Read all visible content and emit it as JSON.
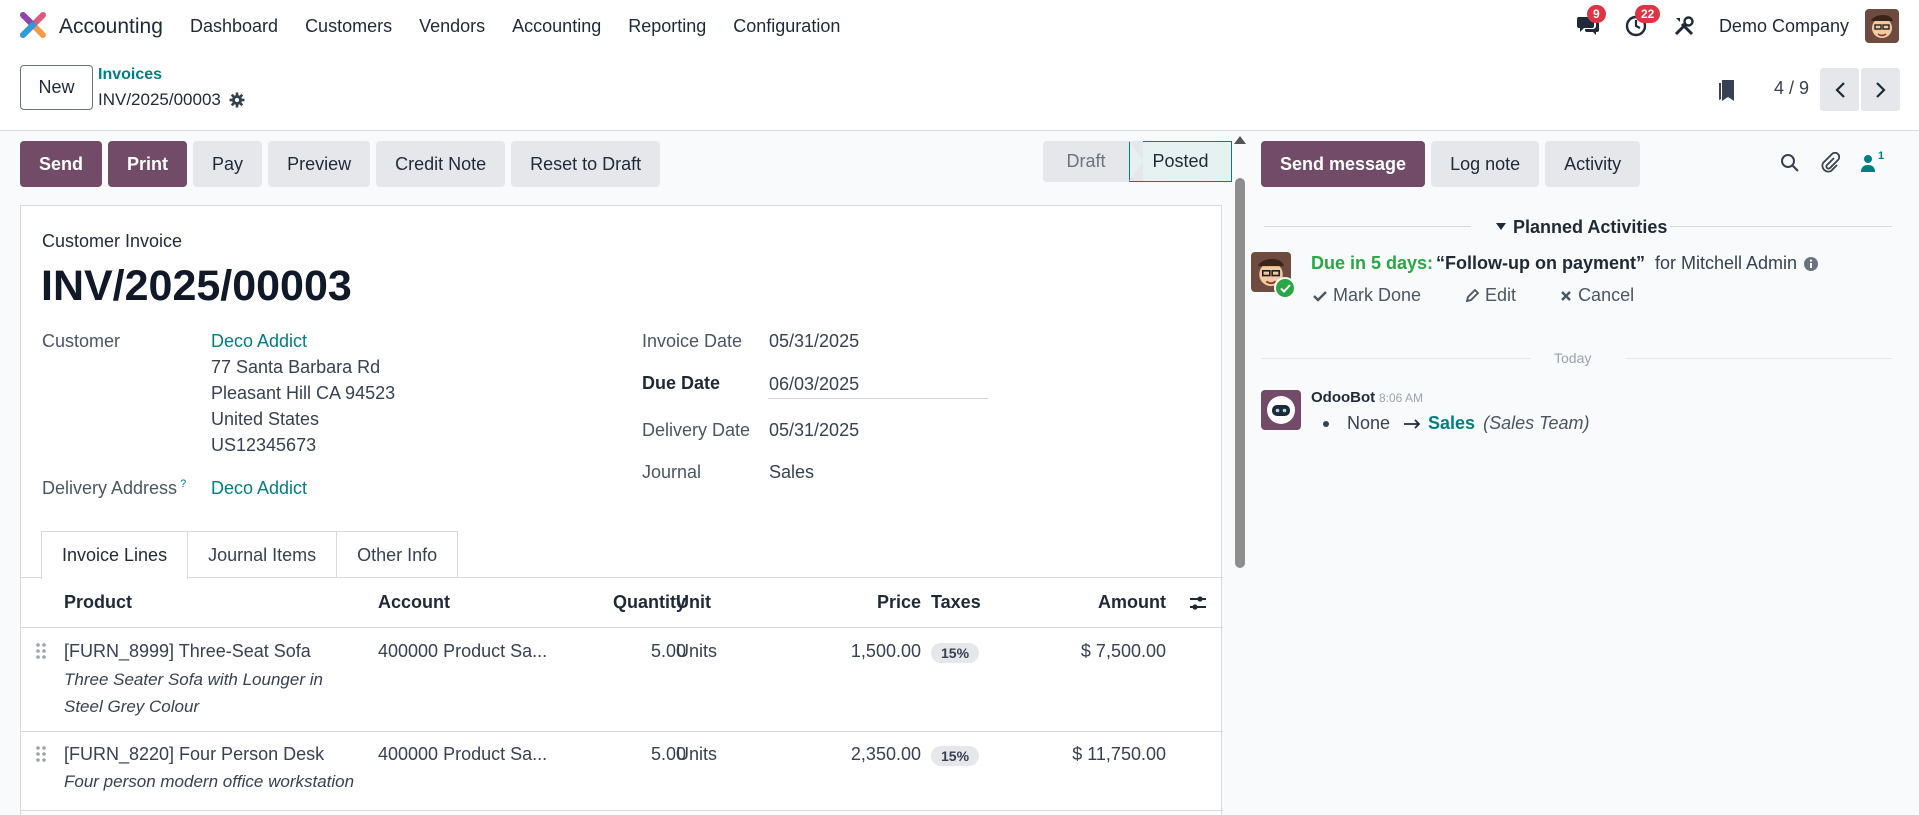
{
  "navbar": {
    "app_name": "Accounting",
    "menu": [
      "Dashboard",
      "Customers",
      "Vendors",
      "Accounting",
      "Reporting",
      "Configuration"
    ],
    "messages_count": "9",
    "activities_count": "22",
    "company": "Demo Company"
  },
  "control_panel": {
    "new_label": "New",
    "breadcrumb_parent": "Invoices",
    "breadcrumb_current": "INV/2025/00003",
    "pager": "4 / 9"
  },
  "actions": {
    "send": "Send",
    "print": "Print",
    "pay": "Pay",
    "preview": "Preview",
    "credit_note": "Credit Note",
    "reset": "Reset to Draft"
  },
  "status": {
    "draft": "Draft",
    "posted": "Posted"
  },
  "invoice": {
    "type": "Customer Invoice",
    "name": "INV/2025/00003",
    "customer_label": "Customer",
    "customer": "Deco Addict",
    "address": [
      "77 Santa Barbara Rd",
      "Pleasant Hill CA 94523",
      "United States",
      "US12345673"
    ],
    "delivery_address_label": "Delivery Address",
    "delivery_address_help": "?",
    "delivery_address": "Deco Addict",
    "invoice_date_label": "Invoice Date",
    "invoice_date": "05/31/2025",
    "due_date_label": "Due Date",
    "due_date": "06/03/2025",
    "delivery_date_label": "Delivery Date",
    "delivery_date": "05/31/2025",
    "journal_label": "Journal",
    "journal": "Sales"
  },
  "tabs": [
    "Invoice Lines",
    "Journal Items",
    "Other Info"
  ],
  "lines": {
    "headers": {
      "product": "Product",
      "account": "Account",
      "quantity": "Quantity",
      "unit": "Unit",
      "price": "Price",
      "taxes": "Taxes",
      "amount": "Amount"
    },
    "rows": [
      {
        "product": "[FURN_8999] Three-Seat Sofa",
        "description": "Three Seater Sofa with Lounger in Steel Grey Colour",
        "account": "400000 Product Sa...",
        "quantity": "5.00",
        "unit": "Units",
        "price": "1,500.00",
        "tax": "15%",
        "amount": "$ 7,500.00"
      },
      {
        "product": "[FURN_8220] Four Person Desk",
        "description": "Four person modern office workstation",
        "account": "400000 Product Sa...",
        "quantity": "5.00",
        "unit": "Units",
        "price": "2,350.00",
        "tax": "15%",
        "amount": "$ 11,750.00"
      }
    ]
  },
  "chatter": {
    "send_message": "Send message",
    "log_note": "Log note",
    "activity": "Activity",
    "followers_count": "1",
    "planned_title": "Planned Activities",
    "activity_due": "Due in 5 days:",
    "activity_summary": "“Follow-up on payment”",
    "activity_for": "for Mitchell Admin",
    "mark_done": "Mark Done",
    "edit": "Edit",
    "cancel": "Cancel",
    "today": "Today",
    "bot_name": "OdooBot",
    "bot_time": "8:06 AM",
    "bot_old": "None",
    "bot_new": "Sales",
    "bot_field": "(Sales Team)"
  },
  "colors": {
    "primary": "#714b67",
    "link": "#017e84",
    "success": "#28a745",
    "badge": "#dc3545"
  }
}
